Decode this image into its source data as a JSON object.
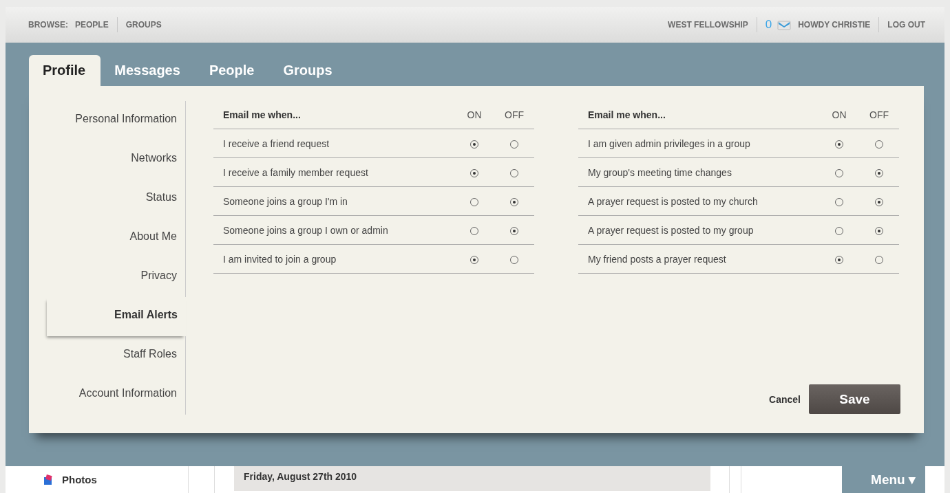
{
  "top_bar": {
    "browse_label": "BROWSE:",
    "browse_links": [
      "PEOPLE",
      "GROUPS"
    ],
    "church": "WEST FELLOWSHIP",
    "message_count": "0",
    "greeting": "HOWDY CHRISTIE",
    "logout": "LOG OUT"
  },
  "tabs": [
    {
      "label": "Profile",
      "selected": true
    },
    {
      "label": "Messages",
      "selected": false
    },
    {
      "label": "People",
      "selected": false
    },
    {
      "label": "Groups",
      "selected": false
    }
  ],
  "sidebar": {
    "items": [
      {
        "label": "Personal Information",
        "selected": false
      },
      {
        "label": "Networks",
        "selected": false
      },
      {
        "label": "Status",
        "selected": false
      },
      {
        "label": "About Me",
        "selected": false
      },
      {
        "label": "Privacy",
        "selected": false
      },
      {
        "label": "Email Alerts",
        "selected": true
      },
      {
        "label": "Staff Roles",
        "selected": false
      },
      {
        "label": "Account Information",
        "selected": false
      }
    ]
  },
  "alert_tables": [
    {
      "heading": "Email me when...",
      "on_label": "ON",
      "off_label": "OFF",
      "rows": [
        {
          "label": "I receive a friend request",
          "on": true
        },
        {
          "label": "I receive a family member request",
          "on": true
        },
        {
          "label": "Someone joins a group I'm in",
          "on": false
        },
        {
          "label": "Someone joins a group I own or admin",
          "on": false
        },
        {
          "label": "I am invited to join a group",
          "on": true
        }
      ]
    },
    {
      "heading": "Email me when...",
      "on_label": "ON",
      "off_label": "OFF",
      "rows": [
        {
          "label": "I am given admin privileges in a group",
          "on": true
        },
        {
          "label": "My group's meeting time changes",
          "on": false
        },
        {
          "label": "A prayer request is posted to my church",
          "on": false
        },
        {
          "label": "A prayer request is posted to my group",
          "on": false
        },
        {
          "label": "My friend posts a prayer request",
          "on": true
        }
      ]
    }
  ],
  "actions": {
    "cancel": "Cancel",
    "save": "Save"
  },
  "footer": {
    "photos": "Photos",
    "date": "Friday, August 27th 2010",
    "menu": "Menu ▾"
  }
}
